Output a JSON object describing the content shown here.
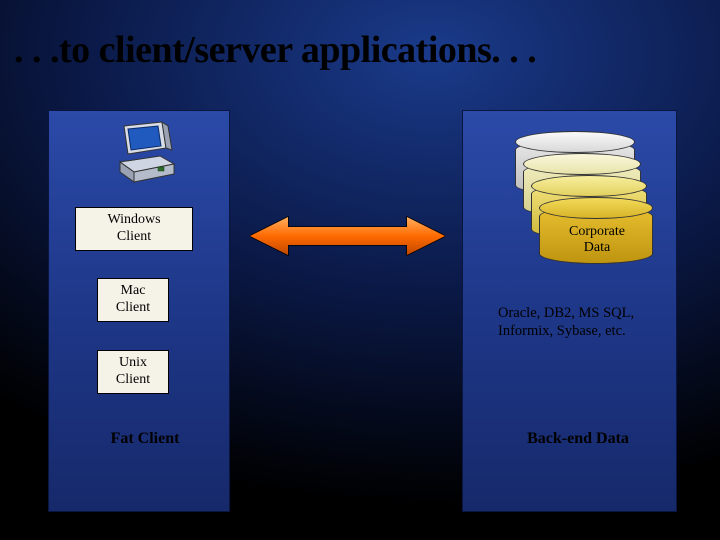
{
  "title": ". . .to client/server applications. . .",
  "left_panel": {
    "clients": [
      {
        "line1": "Windows",
        "line2": "Client"
      },
      {
        "line1": "Mac",
        "line2": "Client"
      },
      {
        "line1": "Unix",
        "line2": "Client"
      }
    ],
    "footer": "Fat Client"
  },
  "right_panel": {
    "corporate_label_line1": "Corporate",
    "corporate_label_line2": "Data",
    "db_list": "Oracle, DB2, MS SQL, Informix, Sybase, etc.",
    "footer": "Back-end Data"
  },
  "colors": {
    "panel_gradient_top": "#2b4aa8",
    "panel_gradient_bottom": "#16296a",
    "arrow_fill": "#ff6a00",
    "arrow_stroke": "#000000"
  }
}
